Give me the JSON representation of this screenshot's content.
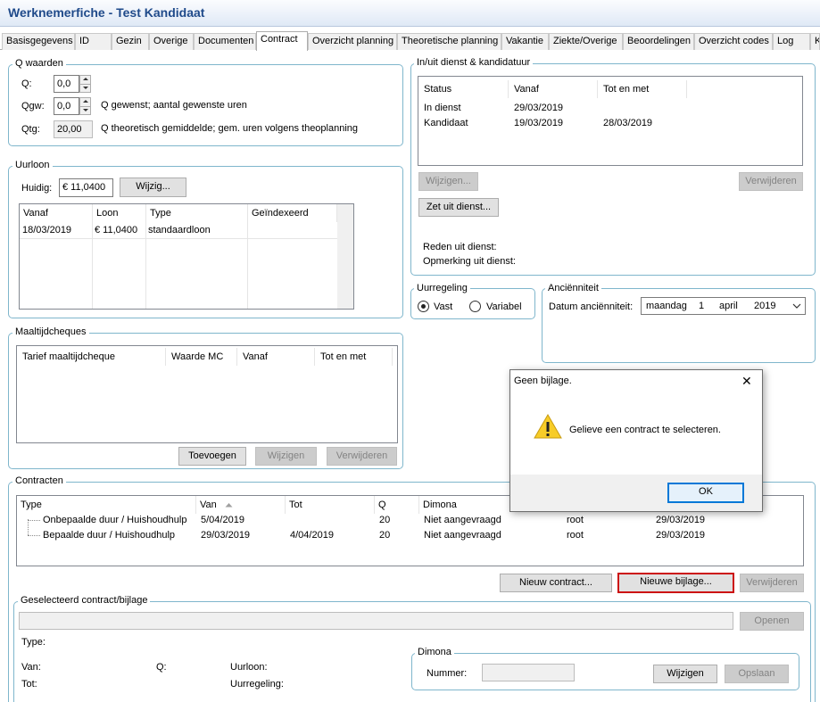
{
  "window": {
    "title": "Werknemerfiche - Test Kandidaat"
  },
  "tabs": [
    {
      "label": "Basisgegevens"
    },
    {
      "label": "ID"
    },
    {
      "label": "Gezin"
    },
    {
      "label": "Overige"
    },
    {
      "label": "Documenten"
    },
    {
      "label": "Contract"
    },
    {
      "label": "Overzicht planning"
    },
    {
      "label": "Theoretische planning"
    },
    {
      "label": "Vakantie"
    },
    {
      "label": "Ziekte/Overige"
    },
    {
      "label": "Beoordelingen"
    },
    {
      "label": "Overzicht codes"
    },
    {
      "label": "Log"
    },
    {
      "label": "K"
    }
  ],
  "q_waarden": {
    "title": "Q waarden",
    "q_label": "Q:",
    "q_value": "0,0",
    "qgw_label": "Qgw:",
    "qgw_value": "0,0",
    "qgw_desc": "Q gewenst; aantal gewenste uren",
    "qtg_label": "Qtg:",
    "qtg_value": "20,00",
    "qtg_desc": "Q theoretisch gemiddelde; gem. uren volgens theoplanning"
  },
  "uurloon": {
    "title": "Uurloon",
    "huidig_label": "Huidig:",
    "huidig_value": "€ 11,0400",
    "wijzig_button": "Wijzig...",
    "columns": [
      "Vanaf",
      "Loon",
      "Type",
      "Geïndexeerd"
    ],
    "rows": [
      {
        "vanaf": "18/03/2019",
        "loon": "€ 11,0400",
        "type": "standaardloon",
        "geindexeerd": ""
      }
    ]
  },
  "maaltijdcheques": {
    "title": "Maaltijdcheques",
    "columns": [
      "Tarief maaltijdcheque",
      "Waarde MC",
      "Vanaf",
      "Tot en met"
    ],
    "add_button": "Toevoegen",
    "edit_button": "Wijzigen",
    "delete_button": "Verwijderen"
  },
  "inuit_dienst": {
    "title": "In/uit dienst & kandidatuur",
    "columns": [
      "Status",
      "Vanaf",
      "Tot en met"
    ],
    "rows": [
      {
        "status": "In dienst",
        "vanaf": "29/03/2019",
        "tot": ""
      },
      {
        "status": "Kandidaat",
        "vanaf": "19/03/2019",
        "tot": "28/03/2019"
      }
    ],
    "edit_button": "Wijzigen...",
    "delete_button": "Verwijderen",
    "out_button": "Zet uit dienst...",
    "reden_label": "Reden uit dienst:",
    "opmerking_label": "Opmerking uit dienst:"
  },
  "uurregeling": {
    "title": "Uurregeling",
    "option_fixed": "Vast",
    "option_variable": "Variabel",
    "selected": "Vast"
  },
  "anciënniteit": {
    "title": "Anciënniteit",
    "label": "Datum anciënniteit:",
    "weekday": "maandag",
    "day": "1",
    "month": "april",
    "year": "2019"
  },
  "contracten": {
    "title": "Contracten",
    "columns": [
      "Type",
      "Van",
      "Tot",
      "Q",
      "Dimona"
    ],
    "rows": [
      {
        "type": "Onbepaalde duur / Huishoudhulp",
        "van": "5/04/2019",
        "tot": "",
        "q": "20",
        "dimona": "Niet aangevraagd",
        "user": "root",
        "date": "29/03/2019"
      },
      {
        "type": "Bepaalde duur / Huishoudhulp",
        "van": "29/03/2019",
        "tot": "4/04/2019",
        "q": "20",
        "dimona": "Niet aangevraagd",
        "user": "root",
        "date": "29/03/2019"
      }
    ],
    "new_contract_button": "Nieuw contract...",
    "new_attachment_button": "Nieuwe bijlage...",
    "delete_button": "Verwijderen"
  },
  "geselecteerd": {
    "title": "Geselecteerd contract/bijlage",
    "open_button": "Openen",
    "type_label": "Type:",
    "van_label": "Van:",
    "tot_label": "Tot:",
    "q_label": "Q:",
    "uurloon_label": "Uurloon:",
    "uurregeling_label": "Uurregeling:"
  },
  "dimona": {
    "title": "Dimona",
    "nummer_label": "Nummer:",
    "edit_button": "Wijzigen",
    "save_button": "Opslaan"
  },
  "dialog": {
    "title": "Geen bijlage.",
    "message": "Gelieve een contract te selecteren.",
    "ok_button": "OK",
    "close_glyph": "✕",
    "icon": "warning-icon"
  }
}
